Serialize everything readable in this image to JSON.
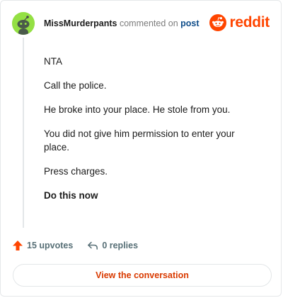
{
  "comment": {
    "username": "MissMurderpants",
    "action_text": "commented on",
    "post_link": "post",
    "paragraphs": [
      "NTA",
      "Call the police.",
      "He broke into your place. He stole from you.",
      "You did not give him permission to enter your place.",
      "Press charges.",
      "Do this now"
    ]
  },
  "brand": {
    "name": "reddit",
    "color": "#ff4500"
  },
  "footer": {
    "upvotes": "15 upvotes",
    "replies": "0 replies",
    "view_button": "View the conversation"
  },
  "avatar": {
    "background": "#94e044",
    "icon": "snoo-avatar-icon"
  }
}
